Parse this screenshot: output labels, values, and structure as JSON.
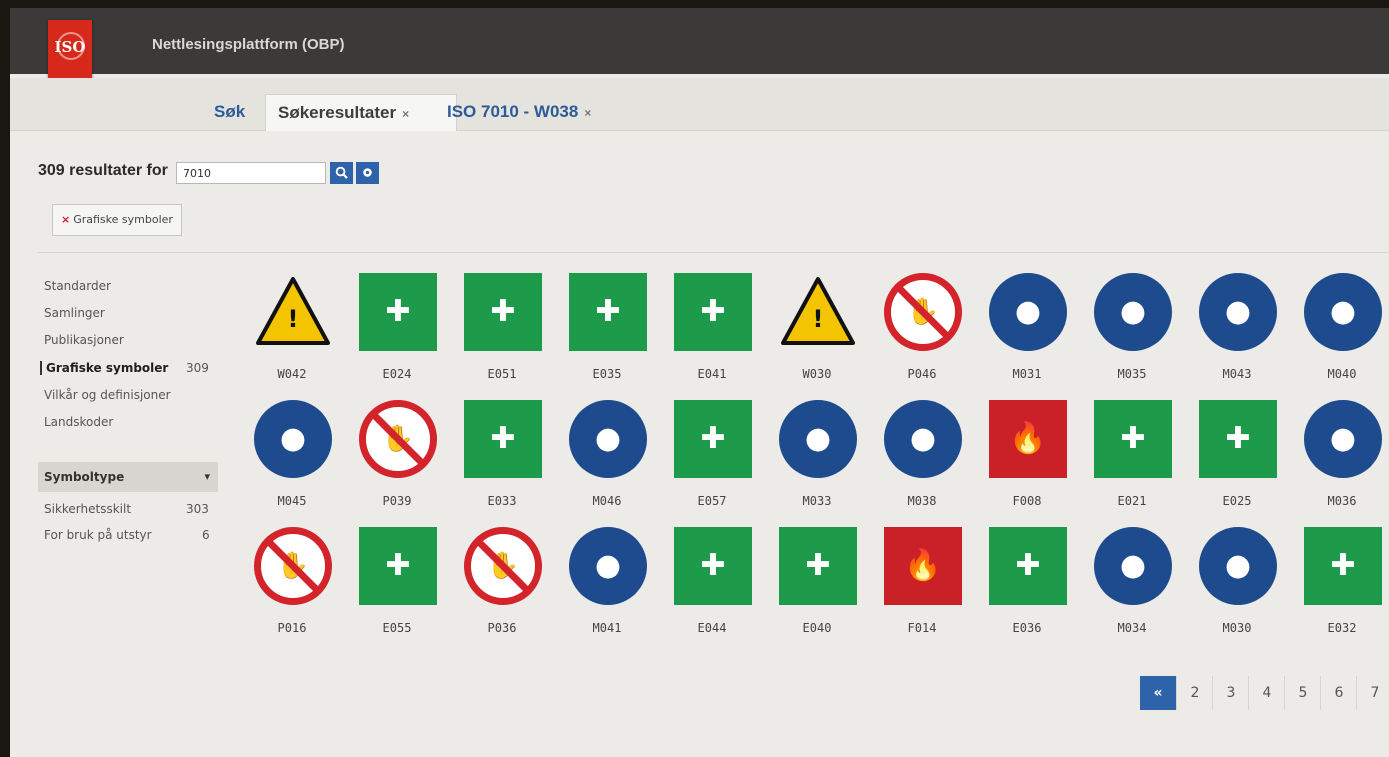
{
  "app": {
    "logo_text": "ISO",
    "title": "Nettlesingsplattform (OBP)"
  },
  "tabs": [
    {
      "label": "Søk"
    },
    {
      "label": "Søkeresultater",
      "close": "×"
    },
    {
      "label": "ISO 7010 - W038",
      "close": "×"
    }
  ],
  "search": {
    "results_text": "309 resultater for",
    "query": "7010"
  },
  "filter_chip": {
    "remove": "×",
    "label": "Grafiske symboler"
  },
  "sidebar": {
    "items": [
      {
        "label": "Standarder",
        "count": ""
      },
      {
        "label": "Samlinger",
        "count": ""
      },
      {
        "label": "Publikasjoner",
        "count": ""
      },
      {
        "label": "Grafiske symboler",
        "count": "309"
      },
      {
        "label": "Vilkår og definisjoner",
        "count": ""
      },
      {
        "label": "Landskoder",
        "count": ""
      }
    ],
    "facet_title": "Symboltype",
    "facet_items": [
      {
        "label": "Sikkerhetsskilt",
        "count": "303"
      },
      {
        "label": "For bruk på utstyr",
        "count": "6"
      }
    ]
  },
  "symbols": [
    {
      "code": "W042",
      "kind": "warning",
      "icon": "battery-discharge-icon"
    },
    {
      "code": "E024",
      "kind": "safe",
      "icon": "wheelchair-assembly-icon"
    },
    {
      "code": "E051",
      "kind": "safe",
      "icon": "emergency-beacon-icon"
    },
    {
      "code": "E035",
      "kind": "safe",
      "icon": "rope-ladder-icon"
    },
    {
      "code": "E041",
      "kind": "safe",
      "icon": "lifebuoy-line-icon"
    },
    {
      "code": "W030",
      "kind": "warning",
      "icon": "hand-crush-icon"
    },
    {
      "code": "P046",
      "kind": "prohibition",
      "icon": "no-sitting-icon"
    },
    {
      "code": "M031",
      "kind": "mandatory",
      "icon": "saw-guard-icon"
    },
    {
      "code": "M035",
      "kind": "mandatory",
      "icon": "climb-pole-icon"
    },
    {
      "code": "M043",
      "kind": "mandatory",
      "icon": "shower-raft-icon"
    },
    {
      "code": "M040",
      "kind": "mandatory",
      "icon": "life-raft-icon"
    },
    {
      "code": "M045",
      "kind": "mandatory",
      "icon": "face-shield-icon"
    },
    {
      "code": "P039",
      "kind": "prohibition",
      "icon": "no-steam-icon"
    },
    {
      "code": "E033",
      "kind": "safe",
      "icon": "exit-door-icon"
    },
    {
      "code": "M046",
      "kind": "mandatory",
      "icon": "cylinder-chain-icon"
    },
    {
      "code": "E057",
      "kind": "safe",
      "icon": "door-exit-icon"
    },
    {
      "code": "M033",
      "kind": "mandatory",
      "icon": "seat-harness-icon"
    },
    {
      "code": "M038",
      "kind": "mandatory",
      "icon": "rotate-hook-icon"
    },
    {
      "code": "F008",
      "kind": "fire",
      "icon": "fire-extinguishers-icon"
    },
    {
      "code": "E021",
      "kind": "safe",
      "icon": "shelter-icon"
    },
    {
      "code": "E025",
      "kind": "safe",
      "icon": "break-glass-icon"
    },
    {
      "code": "M036",
      "kind": "mandatory",
      "icon": "seat-lift-icon"
    },
    {
      "code": "P016",
      "kind": "prohibition",
      "icon": "no-water-spray-icon"
    },
    {
      "code": "E055",
      "kind": "safe",
      "icon": "boarding-ladder-icon"
    },
    {
      "code": "P036",
      "kind": "prohibition",
      "icon": "no-children-icon"
    },
    {
      "code": "M041",
      "kind": "mandatory",
      "icon": "lifeboat-icon"
    },
    {
      "code": "E044",
      "kind": "safe",
      "icon": "lifejacket-icon"
    },
    {
      "code": "E040",
      "kind": "safe",
      "icon": "lifebuoy-icon"
    },
    {
      "code": "F014",
      "kind": "fire",
      "icon": "fire-cylinder-icon"
    },
    {
      "code": "E036",
      "kind": "safe",
      "icon": "liferaft-icon"
    },
    {
      "code": "M034",
      "kind": "mandatory",
      "icon": "seat-belt-icon"
    },
    {
      "code": "M030",
      "kind": "mandatory",
      "icon": "litter-bin-icon"
    },
    {
      "code": "E032",
      "kind": "safe",
      "icon": "assembly-point-icon"
    }
  ],
  "pagination": {
    "first": "«",
    "pages": [
      "2",
      "3",
      "4",
      "5",
      "6",
      "7"
    ]
  },
  "colors": {
    "safe": "#1e9a4b",
    "prohibition": "#d3232b",
    "mandatory": "#1d4b8e",
    "warning": "#f5c400",
    "fire": "#c92127",
    "accent": "#2f63a9"
  }
}
